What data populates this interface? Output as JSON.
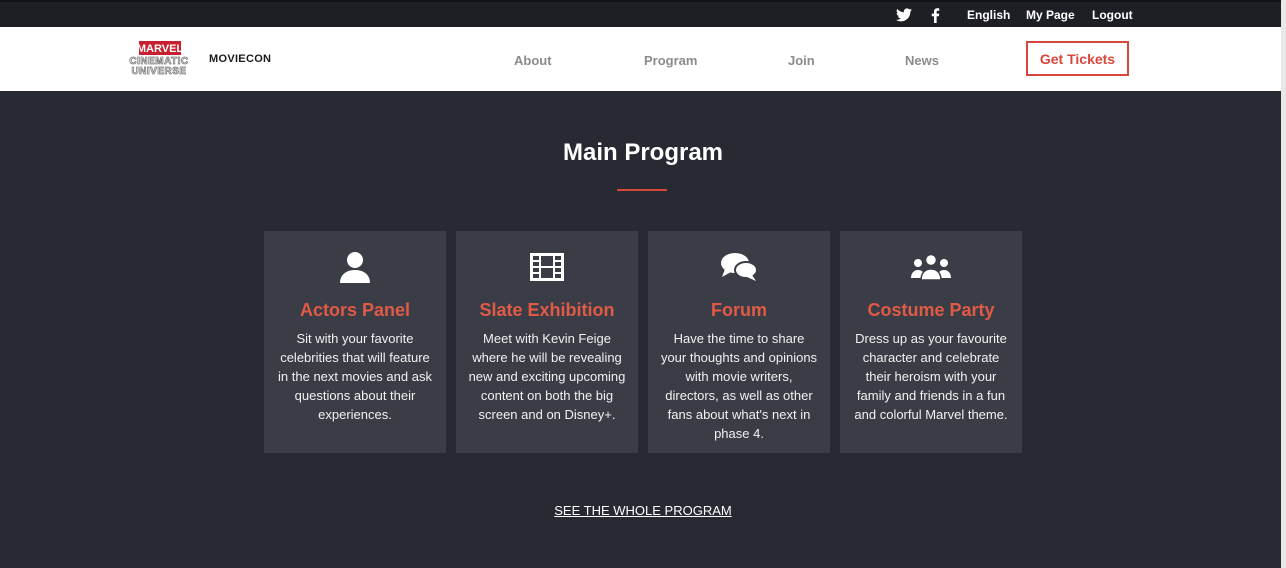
{
  "topbar": {
    "language": "English",
    "my_page": "My Page",
    "logout": "Logout",
    "icons": [
      "twitter-icon",
      "facebook-icon"
    ]
  },
  "nav": {
    "logo_line1": "MARVEL",
    "logo_line2": "CINEMATIC",
    "logo_line3": "UNIVERSE",
    "brand": "MOVIECON",
    "links": [
      "About",
      "Program",
      "Join",
      "News"
    ],
    "cta": "Get Tickets"
  },
  "main": {
    "title": "Main Program",
    "cards": [
      {
        "icon": "user-icon",
        "title": "Actors Panel",
        "text": "Sit with your favorite celebrities that will feature in the next movies and ask questions about their experiences."
      },
      {
        "icon": "film-icon",
        "title": "Slate Exhibition",
        "text": "Meet with Kevin Feige where he will be revealing new and exciting upcoming content on both the big screen and on Disney+."
      },
      {
        "icon": "comments-icon",
        "title": "Forum",
        "text": "Have the time to share your thoughts and opinions with movie writers, directors, as well as other fans about what's next in phase 4."
      },
      {
        "icon": "group-icon",
        "title": "Costume Party",
        "text": "Dress up as your favourite character and celebrate their heroism with your family and friends in a fun and colorful Marvel theme."
      }
    ],
    "see_all": "SEE THE WHOLE PROGRAM"
  },
  "colors": {
    "accent": "#d9463b",
    "background": "#282a33",
    "card": "#3a3d46"
  }
}
